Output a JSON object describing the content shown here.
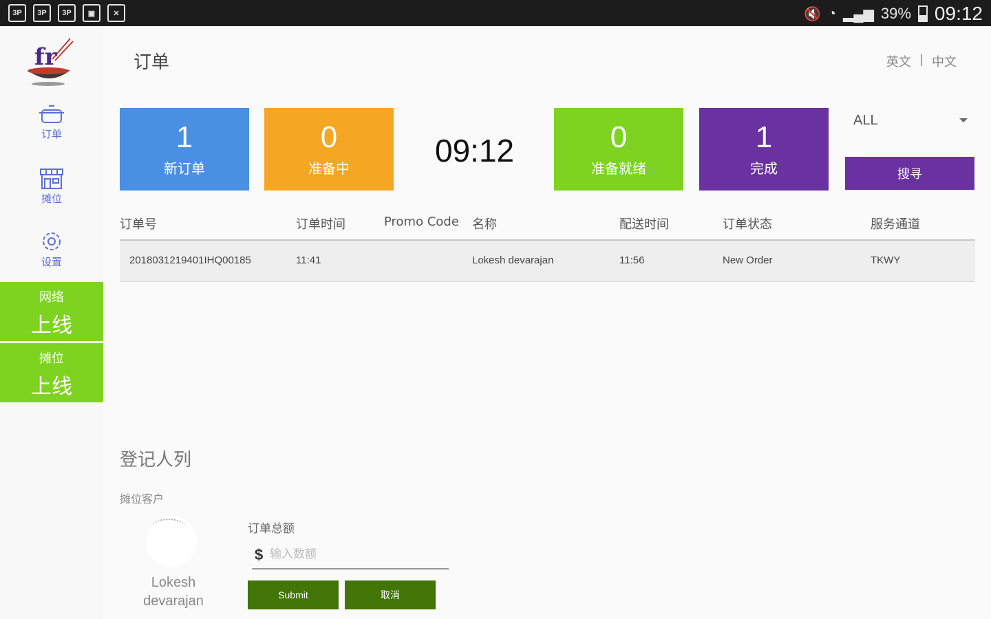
{
  "status_bar": {
    "left_icons": [
      "3P",
      "3P",
      "3P",
      "img-icon",
      "doc-icon"
    ],
    "battery": "39%",
    "time": "09:12"
  },
  "header": {
    "title": "订单",
    "lang_en": "英文",
    "lang_sep": "|",
    "lang_cn": "中文"
  },
  "sidebar": {
    "nav": [
      {
        "label": "订单",
        "icon": "cooking-pot-icon"
      },
      {
        "label": "摊位",
        "icon": "storefront-icon"
      },
      {
        "label": "设置",
        "icon": "gear-icon"
      }
    ],
    "network": {
      "label": "网络",
      "status": "上线"
    },
    "stall": {
      "label": "摊位",
      "status": "上线"
    }
  },
  "stats": {
    "new_orders": {
      "count": "1",
      "label": "新订单",
      "color": "#4a90e2"
    },
    "preparing": {
      "count": "0",
      "label": "准备中",
      "color": "#f5a623"
    },
    "clock": "09:12",
    "ready": {
      "count": "0",
      "label": "准备就绪",
      "color": "#7ed321"
    },
    "completed": {
      "count": "1",
      "label": "完成",
      "color": "#6a31a0"
    }
  },
  "filter": {
    "selected": "ALL",
    "search_label": "搜寻"
  },
  "table": {
    "headers": {
      "order_no": "订单号",
      "order_time": "订单时间",
      "promo": "Promo Code",
      "name": "名称",
      "delivery_time": "配送时间",
      "status": "订单状态",
      "channel": "服务通道"
    },
    "rows": [
      {
        "order_no": "2018031219401IHQ00185",
        "order_time": "11:41",
        "promo": "",
        "name": "Lokesh devarajan",
        "delivery_time": "11:56",
        "status": "New Order",
        "channel": "TKWY"
      }
    ]
  },
  "register": {
    "title": "登记人列",
    "subtitle": "摊位客户",
    "customer_name": "Lokesh devarajan",
    "total_label": "订单总额",
    "currency": "$",
    "amount_placeholder": "输入数额",
    "submit_label": "Submit",
    "cancel_label": "取消"
  }
}
